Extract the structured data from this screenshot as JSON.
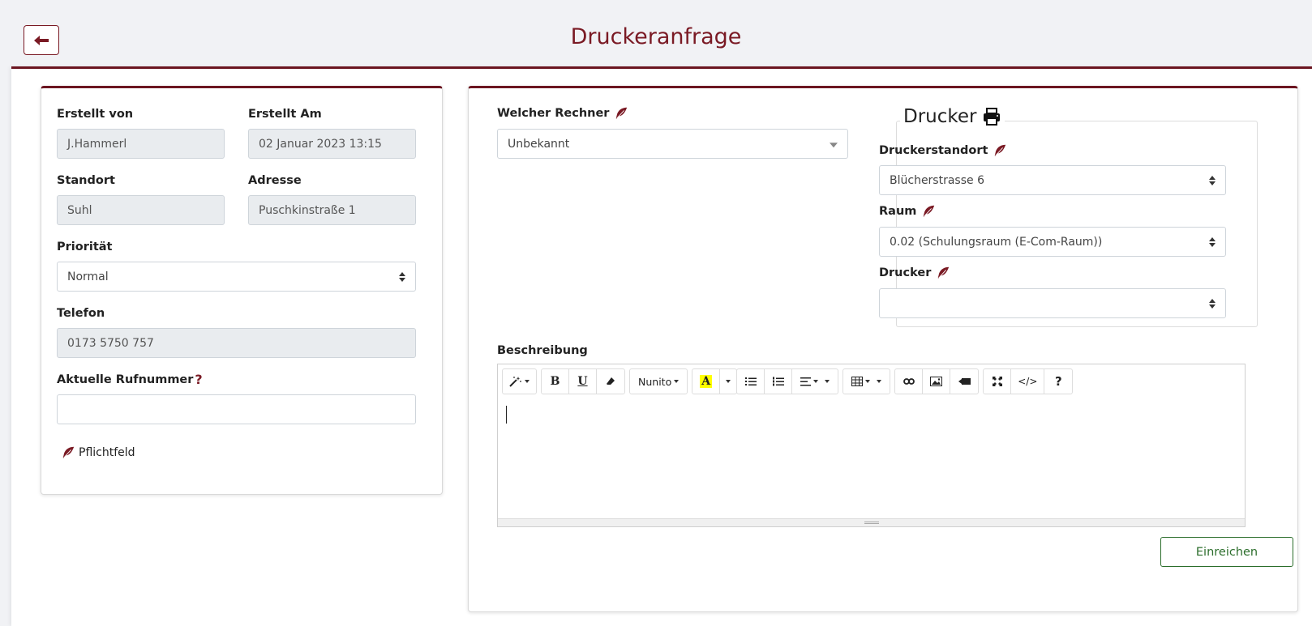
{
  "header": {
    "title": "Druckeranfrage"
  },
  "left": {
    "created_by": {
      "label": "Erstellt von",
      "value": "J.Hammerl"
    },
    "created_at": {
      "label": "Erstellt Am",
      "value": "02 Januar 2023 13:15"
    },
    "location": {
      "label": "Standort",
      "value": "Suhl"
    },
    "address": {
      "label": "Adresse",
      "value": "Puschkinstraße 1"
    },
    "priority": {
      "label": "Priorität",
      "value": "Normal"
    },
    "phone": {
      "label": "Telefon",
      "value": "0173 5750 757"
    },
    "current_number": {
      "label": "Aktuelle Rufnummer",
      "help": "?",
      "value": ""
    },
    "required_note": "Pflichtfeld"
  },
  "right": {
    "computer": {
      "label": "Welcher Rechner",
      "value": "Unbekannt"
    },
    "printer_group": {
      "legend": "Drucker",
      "printer_location": {
        "label": "Druckerstandort",
        "value": "Blücherstrasse 6"
      },
      "room": {
        "label": "Raum",
        "value": "0.02 (Schulungsraum (E-Com-Raum))"
      },
      "printer": {
        "label": "Drucker",
        "value": ""
      }
    },
    "description": {
      "label": "Beschreibung",
      "font_name": "Nunito",
      "bold": "B",
      "underline": "U",
      "highlight": "A",
      "code": "</>",
      "help": "?"
    },
    "submit_label": "Einreichen"
  },
  "colors": {
    "accent": "#7a1a24",
    "submit": "#2c6e2c"
  }
}
